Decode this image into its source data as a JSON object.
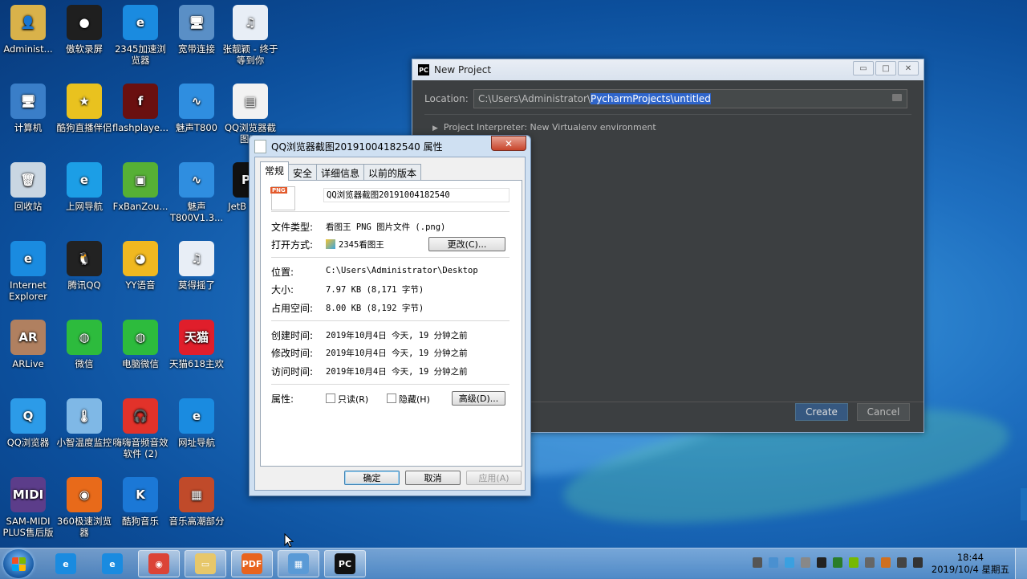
{
  "desktop_icons": [
    {
      "name": "admin",
      "label": "Administ...",
      "glyph": "👤",
      "color": "#d9b24a"
    },
    {
      "name": "aoruan",
      "label": "傲软录屏",
      "glyph": "●",
      "color": "#1f1f1f"
    },
    {
      "name": "2345browser",
      "label": "2345加速浏览器",
      "glyph": "e",
      "color": "#1a8be0"
    },
    {
      "name": "broadband",
      "label": "宽带连接",
      "glyph": "🖥",
      "color": "#5a8fc6"
    },
    {
      "name": "zhangliying",
      "label": "张靓颖 - 终于等到你",
      "glyph": "♫",
      "color": "#e8eef6"
    },
    {
      "name": "computer",
      "label": "计算机",
      "glyph": "🖥",
      "color": "#3a7ec8"
    },
    {
      "name": "kugou-live",
      "label": "酷狗直播伴侣",
      "glyph": "★",
      "color": "#e9c21f"
    },
    {
      "name": "flashplayer",
      "label": "flashplaye...",
      "glyph": "f",
      "color": "#6a1010"
    },
    {
      "name": "meisheng",
      "label": "魅声T800",
      "glyph": "∿",
      "color": "#2f8ee0"
    },
    {
      "name": "qq-screenshot",
      "label": "QQ浏览器截图20",
      "glyph": "▤",
      "color": "#f2f2f2"
    },
    {
      "name": "recycle",
      "label": "回收站",
      "glyph": "🗑",
      "color": "#c9d6e2"
    },
    {
      "name": "web-nav",
      "label": "上网导航",
      "glyph": "e",
      "color": "#1c9ee6"
    },
    {
      "name": "fxbanzou",
      "label": "FxBanZou...",
      "glyph": "▣",
      "color": "#56b035"
    },
    {
      "name": "meisheng2",
      "label": "魅声T800V1.3...",
      "glyph": "∿",
      "color": "#2f8ee0"
    },
    {
      "name": "jetbrains",
      "label": "JetB PyCh",
      "glyph": "PC",
      "color": "#111111"
    },
    {
      "name": "ie",
      "label": "Internet Explorer",
      "glyph": "e",
      "color": "#1a8be0"
    },
    {
      "name": "qq",
      "label": "腾讯QQ",
      "glyph": "🐧",
      "color": "#222222"
    },
    {
      "name": "yy",
      "label": "YY语音",
      "glyph": "◕",
      "color": "#f0b820"
    },
    {
      "name": "mp3-2",
      "label": "莫得摇了",
      "glyph": "♫",
      "color": "#e8eef6"
    },
    {
      "name": "arlive",
      "label": "ARLive",
      "glyph": "AR",
      "color": "#b08060"
    },
    {
      "name": "wechat",
      "label": "微信",
      "glyph": "◍",
      "color": "#2dbb3d"
    },
    {
      "name": "pc-wechat",
      "label": "电脑微信",
      "glyph": "◍",
      "color": "#2dbb3d"
    },
    {
      "name": "tmall",
      "label": "天猫618主欢",
      "glyph": "天猫",
      "color": "#e01e2b"
    },
    {
      "name": "qq-browser",
      "label": "QQ浏览器",
      "glyph": "Q",
      "color": "#2c9be8"
    },
    {
      "name": "temp-monitor",
      "label": "小智温度监控",
      "glyph": "🌡",
      "color": "#7fb8e6"
    },
    {
      "name": "haihai",
      "label": "嗨嗨音频音效软件 (2)",
      "glyph": "🎧",
      "color": "#e2322a"
    },
    {
      "name": "web-nav2",
      "label": "网址导航",
      "glyph": "e",
      "color": "#1a8be0"
    },
    {
      "name": "sam-midi",
      "label": "SAM-MIDI PLUS售后版",
      "glyph": "MIDI",
      "color": "#5c3d8a"
    },
    {
      "name": "360browser",
      "label": "360极速浏览器",
      "glyph": "◉",
      "color": "#e86a1a"
    },
    {
      "name": "kugou",
      "label": "酷狗音乐",
      "glyph": "K",
      "color": "#1b78d6"
    },
    {
      "name": "music-pack",
      "label": "音乐高潮部分",
      "glyph": "▦",
      "color": "#c04a2a"
    }
  ],
  "pycharm": {
    "title": "New Project",
    "location_label": "Location:",
    "location_prefix": "C:\\Users\\Administrator\\",
    "location_selected": "PycharmProjects\\untitled",
    "interpreter_label": "Project Interpreter: New Virtualenv environment",
    "create_label": "Create",
    "cancel_label": "Cancel"
  },
  "props": {
    "title": "QQ浏览器截图20191004182540 属性",
    "close": "✕",
    "tabs": [
      "常规",
      "安全",
      "详细信息",
      "以前的版本"
    ],
    "filename": "QQ浏览器截图20191004182540",
    "file_type_label": "文件类型:",
    "file_type_value": "看图王 PNG 图片文件 (.png)",
    "open_with_label": "打开方式:",
    "open_with_value": "2345看图王",
    "change_btn": "更改(C)...",
    "location_label": "位置:",
    "location_value": "C:\\Users\\Administrator\\Desktop",
    "size_label": "大小:",
    "size_value": "7.97 KB (8,171 字节)",
    "disk_label": "占用空间:",
    "disk_value": "8.00 KB (8,192 字节)",
    "created_label": "创建时间:",
    "created_value": "2019年10月4日 今天, 19 分钟之前",
    "modified_label": "修改时间:",
    "modified_value": "2019年10月4日 今天, 19 分钟之前",
    "accessed_label": "访问时间:",
    "accessed_value": "2019年10月4日 今天, 19 分钟之前",
    "attr_label": "属性:",
    "readonly_label": "只读(R)",
    "hidden_label": "隐藏(H)",
    "advanced_btn": "高级(D)...",
    "ok_btn": "确定",
    "cancel_btn": "取消",
    "apply_btn": "应用(A)"
  },
  "taskbar": {
    "clock_time": "18:44",
    "clock_date": "2019/10/4 星期五",
    "pins": [
      {
        "name": "ie-pin",
        "glyph": "e",
        "color": "#1a8be0",
        "open": false
      },
      {
        "name": "2345-pin",
        "glyph": "e",
        "color": "#1a8be0",
        "open": false
      },
      {
        "name": "chrome-pin",
        "glyph": "◉",
        "color": "#db4437",
        "open": true
      },
      {
        "name": "explorer-pin",
        "glyph": "▭",
        "color": "#e7c76a",
        "open": true
      },
      {
        "name": "pdf-pin",
        "glyph": "PDF",
        "color": "#e8641e",
        "open": true
      },
      {
        "name": "control-pin",
        "glyph": "▦",
        "color": "#5a9ad6",
        "open": true
      },
      {
        "name": "pycharm-pin",
        "glyph": "PC",
        "color": "#111111",
        "open": true
      }
    ]
  }
}
